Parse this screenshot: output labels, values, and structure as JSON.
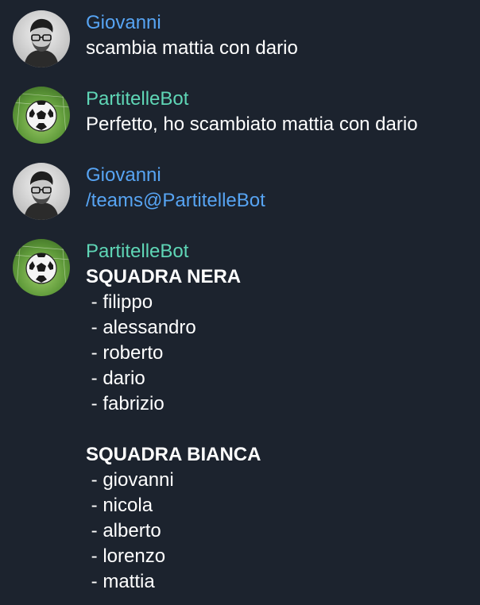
{
  "colors": {
    "background": "#1c232e",
    "user_name": "#57a4f3",
    "bot_name": "#5fd6b6",
    "link": "#57a4f3",
    "text": "#ffffff"
  },
  "messages": [
    {
      "sender": "Giovanni",
      "avatar_icon": "user-avatar",
      "text": "scambia mattia con dario"
    },
    {
      "sender": "PartitelleBot",
      "avatar_icon": "soccer-ball-avatar",
      "text": "Perfetto, ho scambiato mattia con dario"
    },
    {
      "sender": "Giovanni",
      "avatar_icon": "user-avatar",
      "text": "/teams@PartitelleBot"
    },
    {
      "sender": "PartitelleBot",
      "avatar_icon": "soccer-ball-avatar",
      "teams": [
        {
          "title": "SQUADRA NERA",
          "players": [
            " - filippo",
            " - alessandro",
            " - roberto",
            " - dario",
            " - fabrizio"
          ]
        },
        {
          "title": "SQUADRA BIANCA",
          "players": [
            " - giovanni",
            " - nicola",
            " - alberto",
            " - lorenzo",
            " - mattia"
          ]
        }
      ]
    }
  ]
}
